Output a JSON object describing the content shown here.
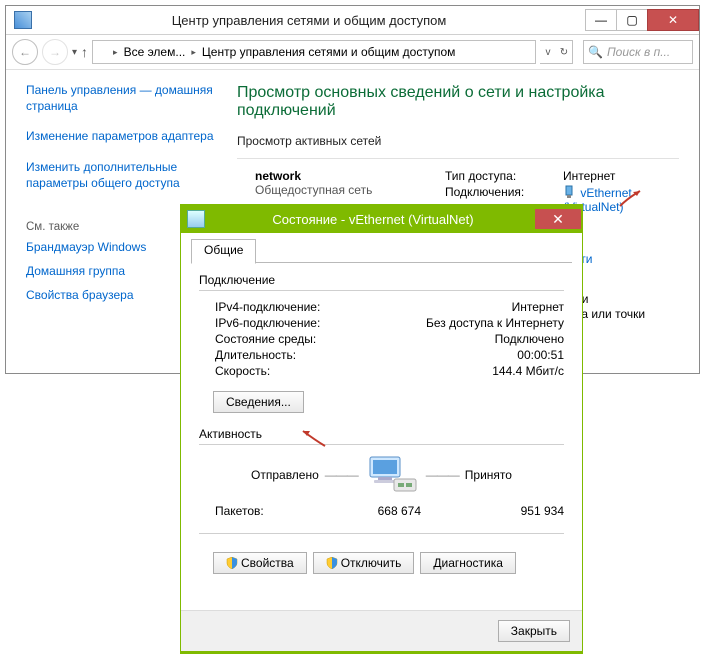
{
  "mainwin": {
    "title": "Центр управления сетями и общим доступом",
    "breadcrumb": {
      "root": "Все элем...",
      "cur": "Центр управления сетями и общим доступом"
    },
    "search_placeholder": "Поиск в п..."
  },
  "sidebar": {
    "home": "Панель управления — домашняя страница",
    "adapter": "Изменение параметров адаптера",
    "sharing": "Изменить дополнительные параметры общего доступа",
    "see_also": "См. также",
    "links": {
      "fw": "Брандмауэр Windows",
      "hg": "Домашняя группа",
      "ie": "Свойства браузера"
    }
  },
  "content": {
    "h1": "Просмотр основных сведений о сети и настройка подключений",
    "active": "Просмотр активных сетей",
    "net_name": "network",
    "net_type": "Общедоступная сеть",
    "access_k": "Тип доступа:",
    "access_v": "Интернет",
    "conn_k": "Подключения:",
    "conn_v1": "vEthernet",
    "conn_v2": "(VirtualNet)"
  },
  "cutoff": {
    "l1": "сети",
    "l2": "или",
    "l3": "ора или точки"
  },
  "dlg": {
    "title": "Состояние - vEthernet (VirtualNet)",
    "tab": "Общие",
    "section_conn": "Подключение",
    "ipv4_k": "IPv4-подключение:",
    "ipv4_v": "Интернет",
    "ipv6_k": "IPv6-подключение:",
    "ipv6_v": "Без доступа к Интернету",
    "media_k": "Состояние среды:",
    "media_v": "Подключено",
    "dur_k": "Длительность:",
    "dur_v": "00:00:51",
    "speed_k": "Скорость:",
    "speed_v": "144.4 Мбит/с",
    "details_btn": "Сведения...",
    "section_act": "Активность",
    "sent": "Отправлено",
    "recv": "Принято",
    "packets_k": "Пакетов:",
    "sent_v": "668 674",
    "recv_v": "951 934",
    "props": "Свойства",
    "disconnect": "Отключить",
    "diag": "Диагностика",
    "close": "Закрыть"
  }
}
